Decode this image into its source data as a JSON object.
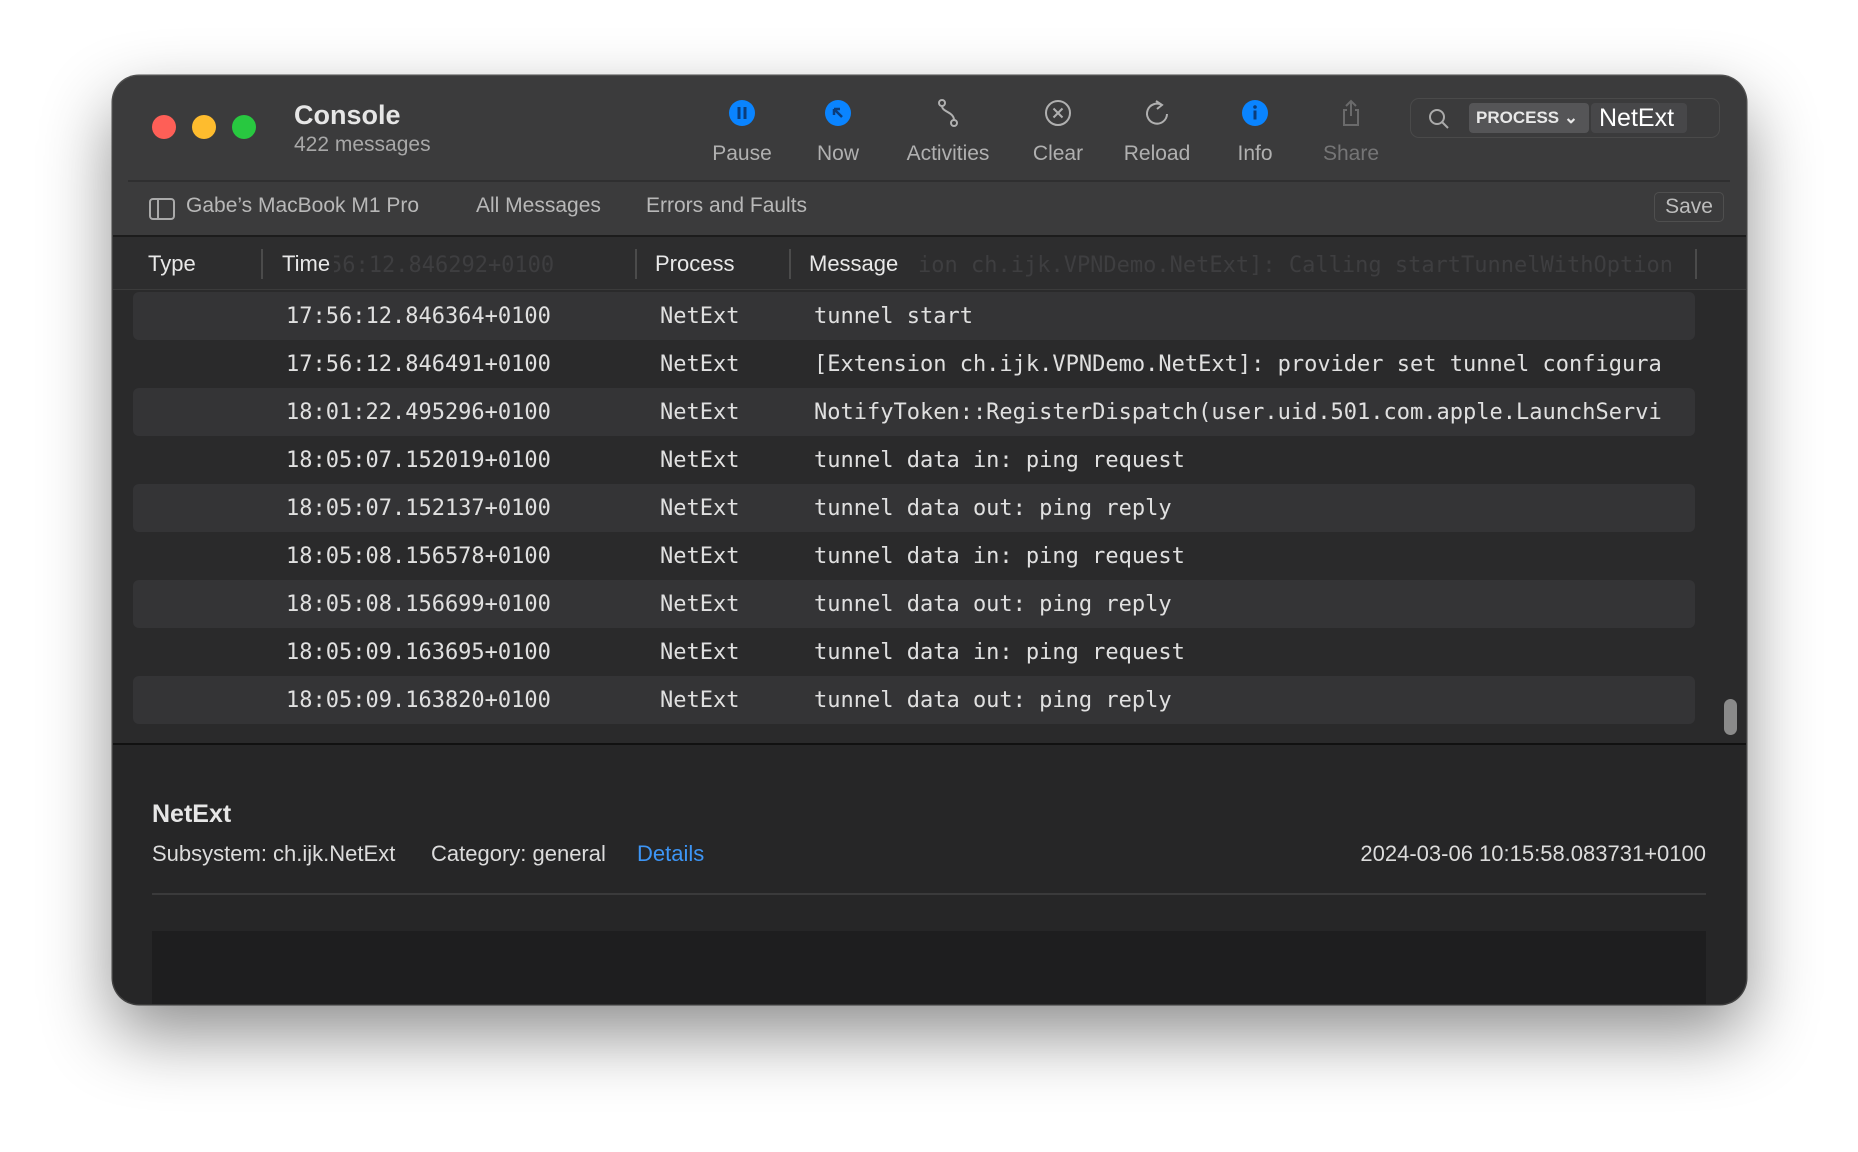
{
  "window": {
    "title": "Console",
    "subtitle": "422 messages"
  },
  "traffic_lights": {
    "close": "#fe5f57",
    "minimize": "#febc2e",
    "zoom": "#28c840"
  },
  "toolbar": [
    {
      "label": "Pause",
      "icon": "pause-icon"
    },
    {
      "label": "Now",
      "icon": "now-arrow-icon"
    },
    {
      "label": "Activities",
      "icon": "activities-icon"
    },
    {
      "label": "Clear",
      "icon": "clear-icon"
    },
    {
      "label": "Reload",
      "icon": "reload-icon"
    },
    {
      "label": "Info",
      "icon": "info-icon"
    },
    {
      "label": "Share",
      "icon": "share-icon"
    }
  ],
  "accent": "#0a84ff",
  "search": {
    "field": "PROCESS",
    "value": "NetExt"
  },
  "filterbar": {
    "device": "Gabe’s MacBook M1 Pro",
    "all": "All Messages",
    "errors": "Errors and Faults",
    "save": "Save"
  },
  "columns": {
    "type": "Type",
    "time": "Time",
    "process": "Process",
    "message": "Message"
  },
  "scrolled_partial": {
    "time": "56:12.846292+0100",
    "message": "ion ch.ijk.VPNDemo.NetExt]: Calling startTunnelWithOption"
  },
  "rows": [
    {
      "time": "17:56:12.846364+0100",
      "process": "NetExt",
      "message": "tunnel start"
    },
    {
      "time": "17:56:12.846491+0100",
      "process": "NetExt",
      "message": "[Extension ch.ijk.VPNDemo.NetExt]: provider set tunnel configura"
    },
    {
      "time": "18:01:22.495296+0100",
      "process": "NetExt",
      "message": "NotifyToken::RegisterDispatch(user.uid.501.com.apple.LaunchServi"
    },
    {
      "time": "18:05:07.152019+0100",
      "process": "NetExt",
      "message": "tunnel data in: ping request"
    },
    {
      "time": "18:05:07.152137+0100",
      "process": "NetExt",
      "message": "tunnel data out: ping reply"
    },
    {
      "time": "18:05:08.156578+0100",
      "process": "NetExt",
      "message": "tunnel data in: ping request"
    },
    {
      "time": "18:05:08.156699+0100",
      "process": "NetExt",
      "message": "tunnel data out: ping reply"
    },
    {
      "time": "18:05:09.163695+0100",
      "process": "NetExt",
      "message": "tunnel data in: ping request"
    },
    {
      "time": "18:05:09.163820+0100",
      "process": "NetExt",
      "message": "tunnel data out: ping reply"
    }
  ],
  "detail": {
    "process": "NetExt",
    "subsystem": "Subsystem: ch.ijk.NetExt",
    "category": "Category: general",
    "details_link": "Details",
    "timestamp": "2024-03-06 10:15:58.083731+0100"
  }
}
